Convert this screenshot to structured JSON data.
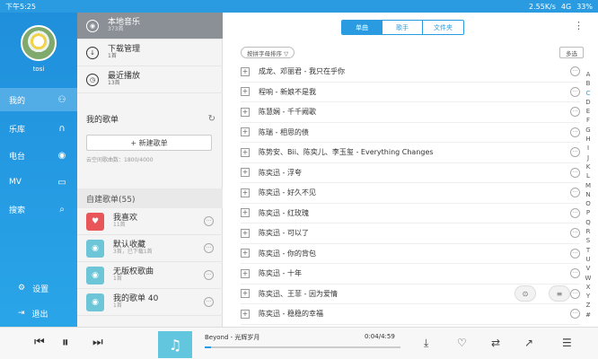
{
  "statusbar": {
    "time": "下午5:25",
    "speed": "2.55K/s",
    "signal": "4G",
    "battery": "33%"
  },
  "nav": {
    "username": "tosi",
    "items": [
      {
        "label": "我的",
        "icon": "person-icon",
        "glyph": "⚇"
      },
      {
        "label": "乐库",
        "icon": "headphones-icon",
        "glyph": "∩"
      },
      {
        "label": "电台",
        "icon": "radio-icon",
        "glyph": "◉"
      },
      {
        "label": "MV",
        "icon": "tv-icon",
        "glyph": "▭"
      },
      {
        "label": "搜索",
        "icon": "search-icon",
        "glyph": "⌕"
      }
    ],
    "settings": "设置",
    "logout": "退出"
  },
  "mid": {
    "local": {
      "title": "本地音乐",
      "sub": "373首"
    },
    "download": {
      "title": "下载管理",
      "sub": "1首"
    },
    "recent": {
      "title": "最近播放",
      "sub": "13首"
    },
    "mysongs_title": "我的歌单",
    "new_list_button": "+ 新建歌单",
    "space_info": "云空间歌曲数：1800/4000",
    "selfbuilt_title": "自建歌单(55)",
    "playlists": [
      {
        "title": "我喜欢",
        "sub": "11首",
        "color": "#e8565a",
        "glyph": "♥"
      },
      {
        "title": "默认收藏",
        "sub": "3首，已下载1首",
        "color": "#6cc6d8",
        "glyph": "◉"
      },
      {
        "title": "无版权歌曲",
        "sub": "1首",
        "color": "#6cc6d8",
        "glyph": "◉"
      },
      {
        "title": "我的歌单 40",
        "sub": "1首",
        "color": "#6cc6d8",
        "glyph": "◉"
      }
    ]
  },
  "main": {
    "tabs": [
      "单曲",
      "歌手",
      "文件夹"
    ],
    "sort_label": "按拼字母排序 ▽",
    "multiselect": "多选",
    "songs": [
      "成龙、邓丽君 - 我只在乎你",
      "程响 - 新娘不是我",
      "陈慧娴 - 千千阙歌",
      "陈瑞 - 相思的债",
      "陈势安、Bii、陈奕儿、李玉玺 - Everything Changes",
      "陈奕迅 - 浮夸",
      "陈奕迅 - 好久不见",
      "陈奕迅 - 红玫瑰",
      "陈奕迅 - 可以了",
      "陈奕迅 - 你的背包",
      "陈奕迅 - 十年",
      "陈奕迅、王菲 - 因为爱情",
      "陈奕迅 - 稳稳的幸福"
    ],
    "az": [
      "A",
      "B",
      "C",
      "D",
      "E",
      "F",
      "G",
      "H",
      "I",
      "J",
      "K",
      "L",
      "M",
      "N",
      "O",
      "P",
      "Q",
      "R",
      "S",
      "T",
      "U",
      "V",
      "W",
      "X",
      "Y",
      "Z",
      "#"
    ],
    "az_current": "C"
  },
  "player": {
    "track": "Beyond - 光辉岁月",
    "time": "0:04/4:59",
    "progress": 0.03
  }
}
